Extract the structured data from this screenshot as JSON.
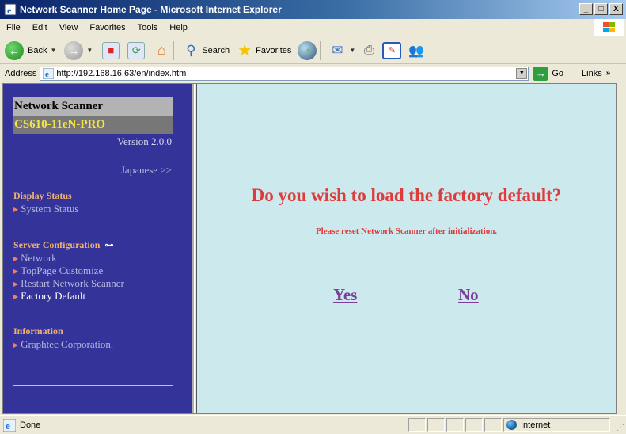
{
  "window": {
    "title": "Network Scanner Home Page - Microsoft Internet Explorer",
    "controls": {
      "minimize": "_",
      "maximize": "□",
      "close": "X"
    }
  },
  "menubar": {
    "items": [
      {
        "label": "File",
        "accel": "F"
      },
      {
        "label": "Edit",
        "accel": "E"
      },
      {
        "label": "View",
        "accel": "V"
      },
      {
        "label": "Favorites",
        "accel": "a"
      },
      {
        "label": "Tools",
        "accel": "T"
      },
      {
        "label": "Help",
        "accel": "H"
      }
    ]
  },
  "toolbar": {
    "back_label": "Back",
    "search_label": "Search",
    "favorites_label": "Favorites",
    "icons": [
      "back-icon",
      "forward-icon",
      "stop-icon",
      "refresh-icon",
      "home-icon",
      "search-icon",
      "favorites-star-icon",
      "history-icon",
      "mail-icon",
      "print-icon",
      "edit-icon",
      "messenger-icon"
    ]
  },
  "addressbar": {
    "label": "Address",
    "url": "http://192.168.16.63/en/index.htm",
    "go_label": "Go",
    "links_label": "Links",
    "links_chevron": "»"
  },
  "sidebar": {
    "product_name": "Network Scanner",
    "model": "CS610-11eN-PRO",
    "version": "Version 2.0.0",
    "language_link": "Japanese >>",
    "sections": [
      {
        "title": "Display Status",
        "items": [
          {
            "label": "System Status",
            "active": false
          }
        ]
      },
      {
        "title": "Server Configuration",
        "has_key_icon": true,
        "items": [
          {
            "label": "Network",
            "active": false
          },
          {
            "label": "TopPage Customize",
            "active": false
          },
          {
            "label": "Restart Network Scanner",
            "active": false
          },
          {
            "label": "Factory Default",
            "active": true
          }
        ]
      },
      {
        "title": "Information",
        "items": [
          {
            "label": "Graphtec Corporation.",
            "active": false
          }
        ]
      }
    ]
  },
  "content": {
    "question": "Do you wish to load the factory default?",
    "note": "Please reset Network Scanner after initialization.",
    "yes_label": "Yes",
    "no_label": "No"
  },
  "statusbar": {
    "status": "Done",
    "zone": "Internet"
  },
  "colors": {
    "sidebar_bg": "#333399",
    "content_bg": "#cceaed",
    "heading_red": "#e03a3a",
    "section_orange": "#f0b070",
    "model_yellow": "#f5e34a",
    "link_purple": "#7a3f99"
  }
}
